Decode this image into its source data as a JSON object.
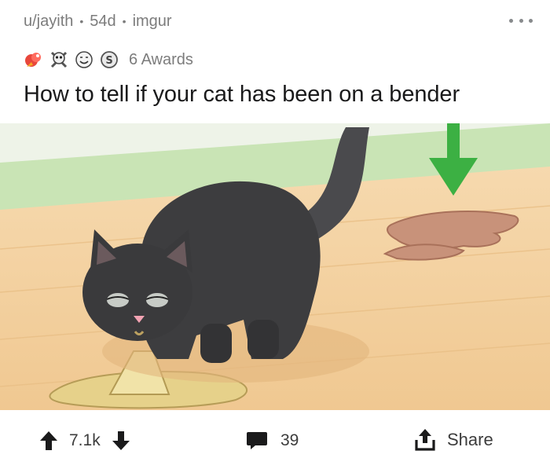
{
  "post": {
    "author": "u/jayith",
    "age": "54d",
    "source": "imgur",
    "awards_label": "6 Awards",
    "title": "How to tell if your cat has been on a bender",
    "image_alt": "Illustration of a black cat vomiting on a wooden floor next to another puddle marked by a green arrow"
  },
  "awards": [
    {
      "icon": "rocket-like-award-icon"
    },
    {
      "icon": "skull-award-icon"
    },
    {
      "icon": "smile-award-icon"
    },
    {
      "icon": "silver-coin-award-icon"
    }
  ],
  "actions": {
    "upvotes": "7.1k",
    "comments": "39",
    "share_label": "Share"
  },
  "colors": {
    "meta_gray": "#7c7c7c",
    "arrow_green": "#3cb043",
    "floor": "#f3cf9e",
    "wall_green": "#b9dca6",
    "cat": "#3d3d3f"
  }
}
